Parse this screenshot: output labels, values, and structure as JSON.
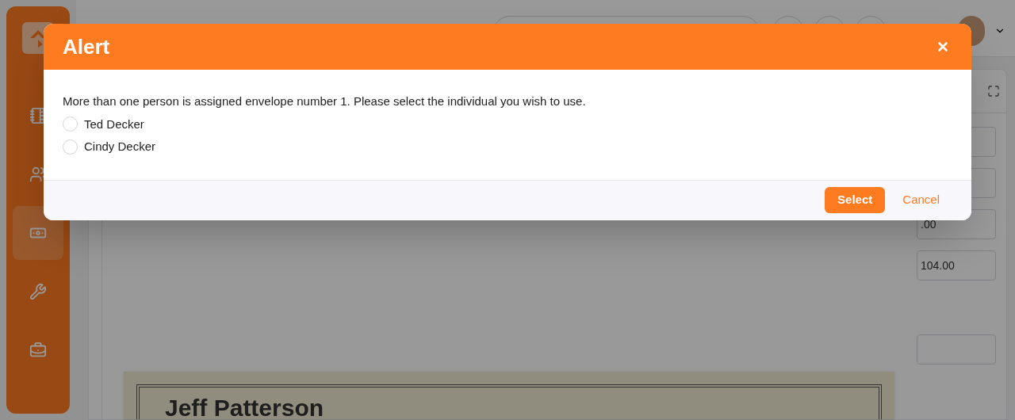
{
  "sidebar": {
    "items": [
      {
        "selected": false
      },
      {
        "selected": false
      },
      {
        "selected": true
      },
      {
        "selected": false
      },
      {
        "selected": false
      }
    ]
  },
  "detail_fields": [
    {
      "value": ".00"
    },
    {
      "value": "104.00"
    }
  ],
  "document": {
    "name": "Jeff Patterson"
  },
  "dialog": {
    "title": "Alert",
    "message": "More than one person is assigned envelope number 1. Please select the individual you wish to use.",
    "options": [
      {
        "label": "Ted Decker",
        "selected": false
      },
      {
        "label": "Cindy Decker",
        "selected": false
      }
    ],
    "buttons": [
      {
        "label": "Select",
        "kind": "primary"
      },
      {
        "label": "Cancel",
        "kind": "link"
      }
    ]
  }
}
